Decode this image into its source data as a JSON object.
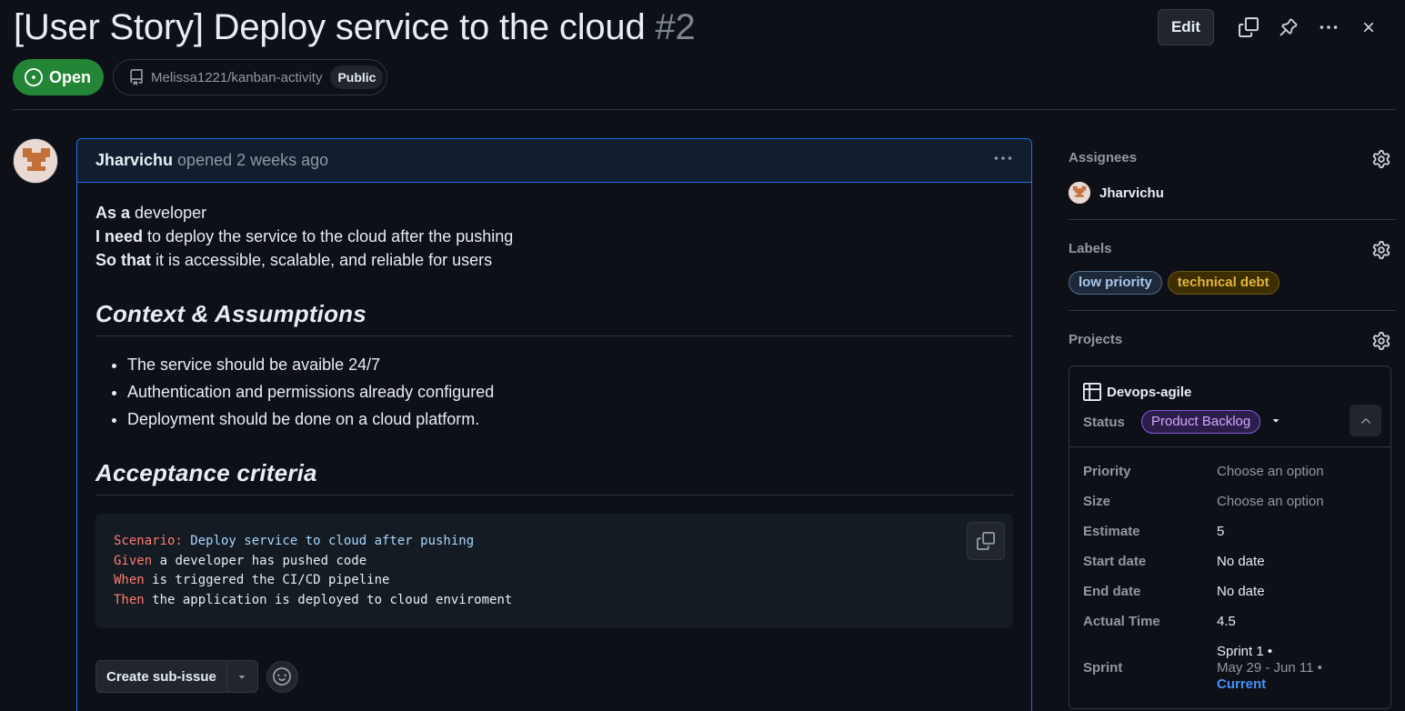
{
  "issue": {
    "title": "[User Story] Deploy service to the cloud",
    "number": "#2",
    "state": "Open",
    "repo": "Melissa1221/kanban-activity",
    "visibility": "Public"
  },
  "toolbar": {
    "edit_label": "Edit",
    "icons": [
      "copy-icon",
      "pin-icon",
      "kebab-horizontal-icon",
      "close-icon"
    ]
  },
  "comment": {
    "author": "Jharvichu",
    "opened": "opened 2 weeks ago",
    "story": {
      "as_a_label": "As a",
      "as_a_text": " developer",
      "i_need_label": "I need",
      "i_need_text": " to deploy the service to the cloud after the pushing",
      "so_that_label": "So that",
      "so_that_text": " it is accessible, scalable, and reliable for users"
    },
    "context_heading": "Context & Assumptions",
    "context_items": [
      "The service should be avaible 24/7",
      "Authentication and permissions already configured",
      "Deployment should be done on a cloud platform."
    ],
    "acceptance_heading": "Acceptance criteria",
    "code": {
      "line1_kw": "Scenario:",
      "line1_text": " Deploy service to cloud after pushing",
      "line2_kw": "Given",
      "line2_text": " a developer has pushed code",
      "line3_kw": "When",
      "line3_text": " is triggered the CI/CD pipeline",
      "line4_kw": "Then",
      "line4_text": " the application is deployed to cloud enviroment"
    },
    "create_sub_issue": "Create sub-issue"
  },
  "sidebar": {
    "assignees_title": "Assignees",
    "assignee": "Jharvichu",
    "labels_title": "Labels",
    "labels": [
      {
        "name": "low priority",
        "color": "#a8c7ed"
      },
      {
        "name": "technical debt",
        "color": "#e3b341"
      }
    ],
    "projects_title": "Projects",
    "project": {
      "name": "Devops-agile",
      "status_label": "Status",
      "status_value": "Product Backlog",
      "fields": [
        {
          "name": "Priority",
          "value": "Choose an option"
        },
        {
          "name": "Size",
          "value": "Choose an option"
        },
        {
          "name": "Estimate",
          "value": "5"
        },
        {
          "name": "Start date",
          "value": "No date"
        },
        {
          "name": "End date",
          "value": "No date"
        },
        {
          "name": "Actual Time",
          "value": "4.5"
        }
      ],
      "sprint_label": "Sprint",
      "sprint_name": "Sprint 1 •",
      "sprint_dates": "May 29 - Jun 11 •",
      "sprint_current": "Current"
    }
  },
  "colors": {
    "accent_open": "#238636",
    "link": "#4493f8",
    "background": "#0d1117"
  }
}
